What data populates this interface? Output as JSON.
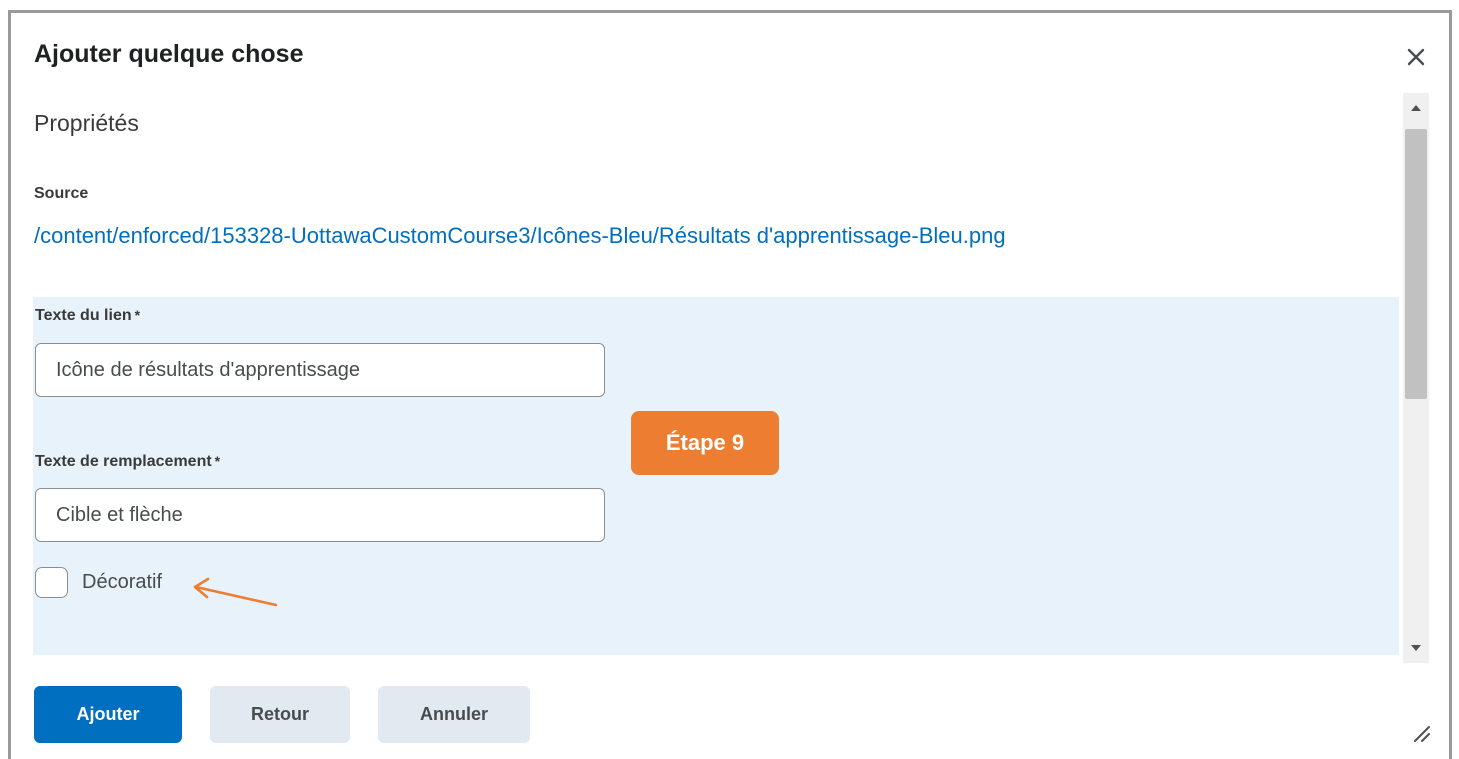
{
  "dialog": {
    "title": "Ajouter quelque chose",
    "close_icon": "close-icon"
  },
  "properties": {
    "heading": "Propriétés",
    "source_label": "Source",
    "source_path": "/content/enforced/153328-UottawaCustomCourse3/Icônes-Bleu/Résultats d'apprentissage-Bleu.png",
    "link_text_label": "Texte du lien",
    "link_text_value": "Icône de résultats d'apprentissage",
    "alt_text_label": "Texte de remplacement",
    "alt_text_value": "Cible et flèche",
    "required_marker": "*",
    "decorative_label": "Décoratif",
    "decorative_checked": false
  },
  "annotation": {
    "step_label": "Étape 9",
    "accent_color": "#ed7d31"
  },
  "footer": {
    "add_label": "Ajouter",
    "back_label": "Retour",
    "cancel_label": "Annuler"
  },
  "colors": {
    "primary": "#006fbf",
    "link": "#006fbf",
    "panel_highlight": "#e8f2fa",
    "secondary_button": "#e3e9f1"
  }
}
